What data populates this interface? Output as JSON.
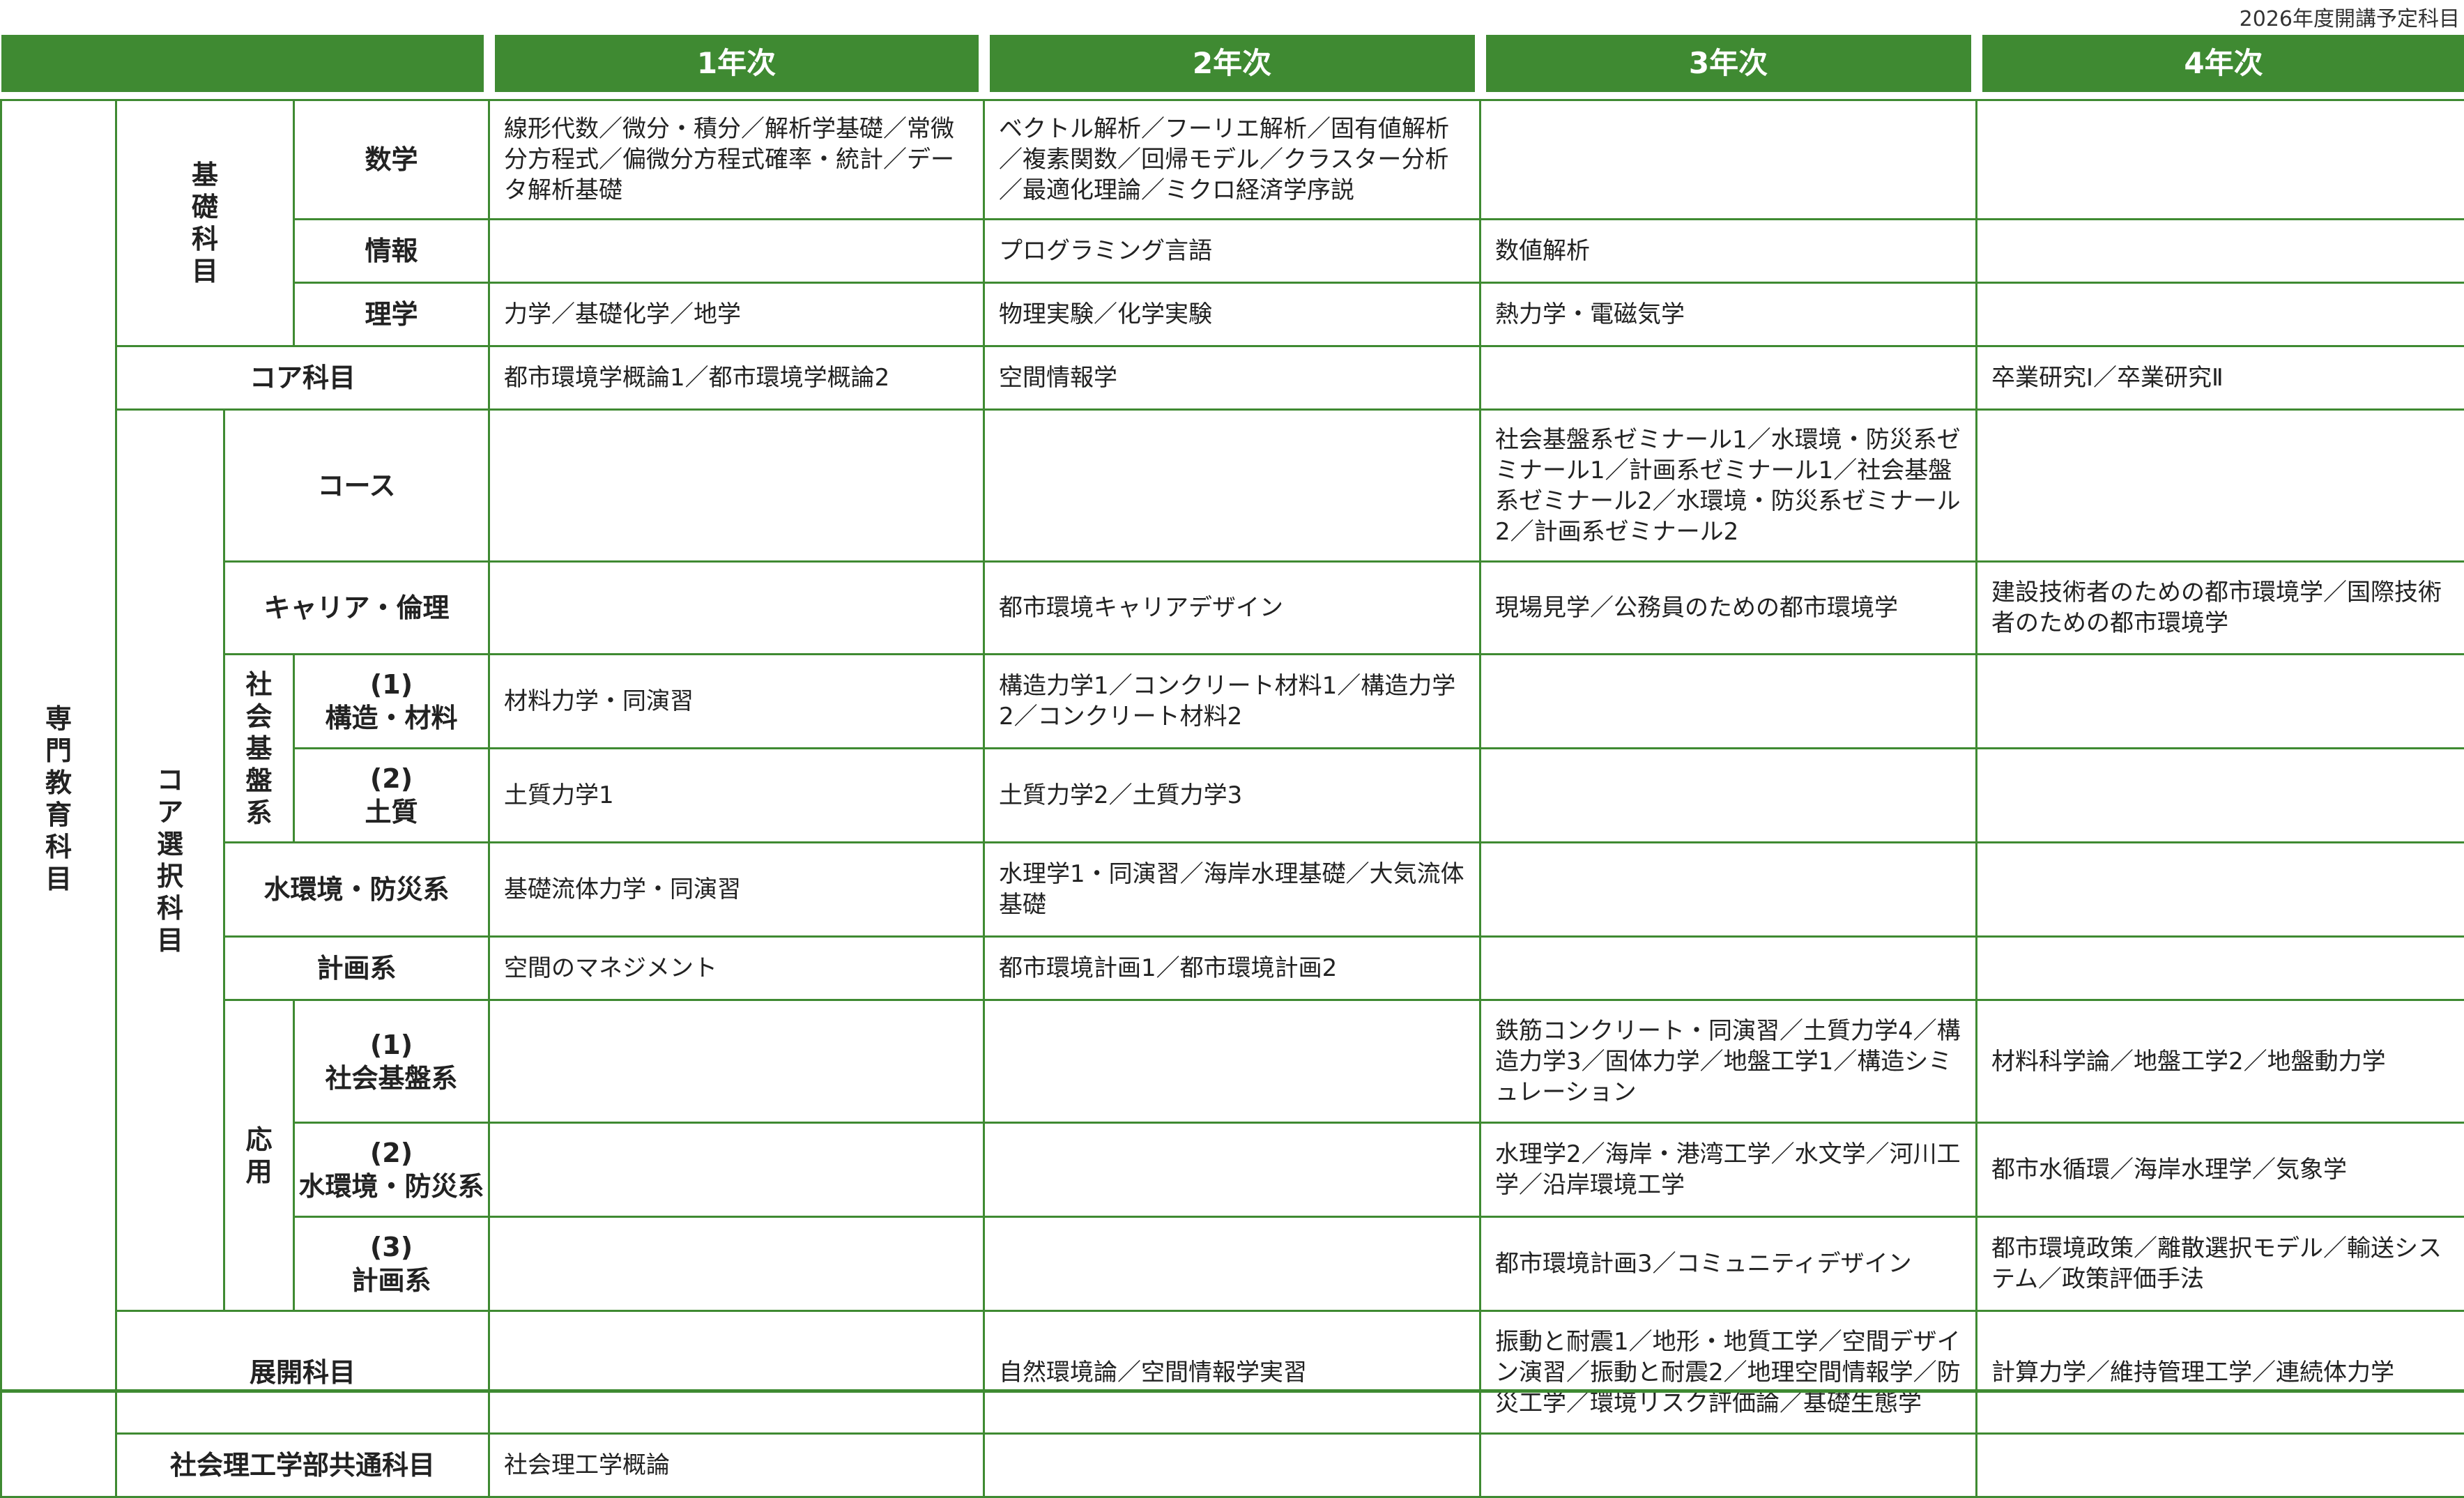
{
  "note": "2026年度開講予定科目",
  "years": [
    "1年次",
    "2年次",
    "3年次",
    "4年次"
  ],
  "labels": {
    "senmon": "専門教育科目",
    "kiso": "基礎科目",
    "sugaku": "数学",
    "joho": "情報",
    "rigaku": "理学",
    "core": "コア科目",
    "core_sentaku": "コア選択科目",
    "course": "コース",
    "career": "キャリア・倫理",
    "shakai_kiban_kei": "社会基盤系",
    "kozo_num": "(1)",
    "kozo": "構造・材料",
    "dositsu_num": "(2)",
    "dositsu": "土質",
    "mizu": "水環境・防災系",
    "keikaku": "計画系",
    "oyo": "応用",
    "o1_num": "(1)",
    "o1": "社会基盤系",
    "o2_num": "(2)",
    "o2": "水環境・防災系",
    "o3_num": "(3)",
    "o3": "計画系",
    "tenkai": "展開科目",
    "kyotsu": "社会理工学部共通科目"
  },
  "rows": {
    "sugaku": [
      "線形代数／微分・積分／解析学基礎／常微分方程式／偏微分方程式確率・統計／データ解析基礎",
      "ベクトル解析／フーリエ解析／固有値解析／複素関数／回帰モデル／クラスター分析／最適化理論／ミクロ経済学序説",
      "",
      ""
    ],
    "joho": [
      "",
      "プログラミング言語",
      "数値解析",
      ""
    ],
    "rigaku": [
      "力学／基礎化学／地学",
      "物理実験／化学実験",
      "熱力学・電磁気学",
      ""
    ],
    "core": [
      "都市環境学概論1／都市環境学概論2",
      "空間情報学",
      "",
      "卒業研究Ⅰ／卒業研究Ⅱ"
    ],
    "course": [
      "",
      "",
      "社会基盤系ゼミナール1／水環境・防災系ゼミナール1／計画系ゼミナール1／社会基盤系ゼミナール2／水環境・防災系ゼミナール2／計画系ゼミナール2",
      ""
    ],
    "career": [
      "",
      "都市環境キャリアデザイン",
      "現場見学／公務員のための都市環境学",
      "建設技術者のための都市環境学／国際技術者のための都市環境学"
    ],
    "kozo": [
      "材料力学・同演習",
      "構造力学1／コンクリート材料1／構造力学2／コンクリート材料2",
      "",
      ""
    ],
    "dositsu": [
      "土質力学1",
      "土質力学2／土質力学3",
      "",
      ""
    ],
    "mizu": [
      "基礎流体力学・同演習",
      "水理学1・同演習／海岸水理基礎／大気流体基礎",
      "",
      ""
    ],
    "keikaku": [
      "空間のマネジメント",
      "都市環境計画1／都市環境計画2",
      "",
      ""
    ],
    "o1": [
      "",
      "",
      "鉄筋コンクリート・同演習／土質力学4／構造力学3／固体力学／地盤工学1／構造シミュレーション",
      "材料科学論／地盤工学2／地盤動力学"
    ],
    "o2": [
      "",
      "",
      "水理学2／海岸・港湾工学／水文学／河川工学／沿岸環境工学",
      "都市水循環／海岸水理学／気象学"
    ],
    "o3": [
      "",
      "",
      "都市環境計画3／コミュニティデザイン",
      "都市環境政策／離散選択モデル／輸送システム／政策評価手法"
    ],
    "tenkai": [
      "",
      "自然環境論／空間情報学実習",
      "振動と耐震1／地形・地質工学／空間デザイン演習／振動と耐震2／地理空間情報学／防災工学／環境リスク評価論／基礎生態学",
      "計算力学／維持管理工学／連続体力学"
    ],
    "kyotsu": [
      "社会理工学概論",
      "",
      "",
      ""
    ]
  },
  "colors": {
    "accent": "#3f8a32",
    "header_text": "#ffffff"
  }
}
